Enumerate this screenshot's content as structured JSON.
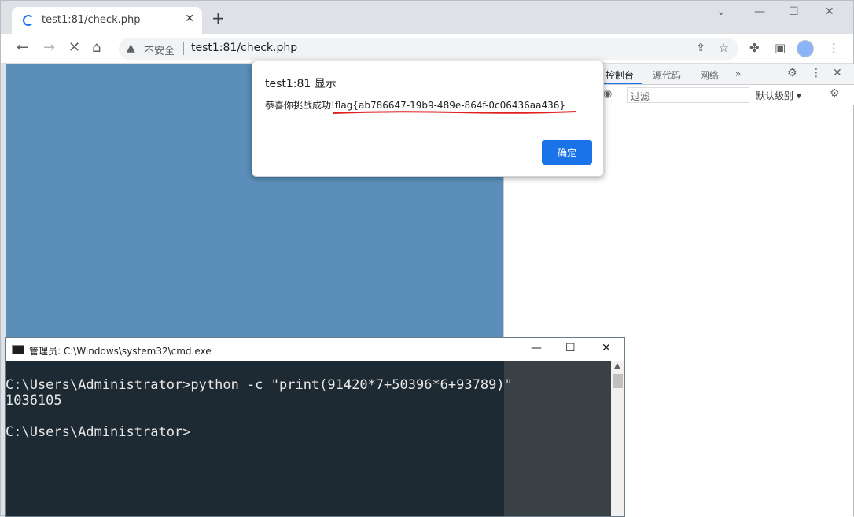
{
  "browser": {
    "tab_title": "test1:81/check.php",
    "url": "test1:81/check.php",
    "security_label": "不安全"
  },
  "devtools": {
    "tabs": [
      "控制台",
      "源代码",
      "网络"
    ],
    "active_tab": "控制台",
    "filter_placeholder": "过滤",
    "level_label": "默认级别 ▾"
  },
  "dialog": {
    "title": "test1:81 显示",
    "message": "恭喜你挑战成功!flag{ab786647-19b9-489e-864f-0c06436aa436}",
    "ok_label": "确定"
  },
  "cmd": {
    "title": "管理员: C:\\Windows\\system32\\cmd.exe",
    "lines": [
      "C:\\Users\\Administrator>python -c \"print(91420*7+50396*6+93789)\"",
      "1036105",
      "",
      "C:\\Users\\Administrator>"
    ]
  },
  "colors": {
    "page_bg": "#5b8fb9",
    "accent": "#1a73e8",
    "console_bg": "#1e2a33"
  }
}
